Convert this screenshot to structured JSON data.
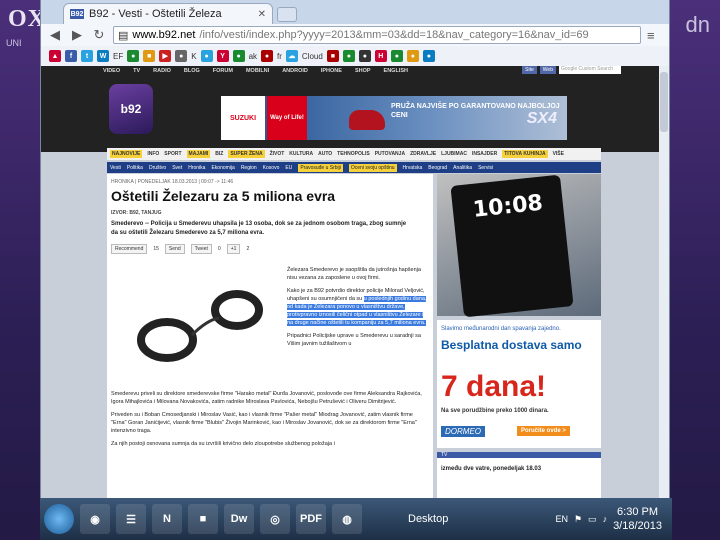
{
  "slide": {
    "title": "OXFORD",
    "subtitle": "UNI",
    "right_text": "dn"
  },
  "browser": {
    "tab_favicon": "B92",
    "tab_title": "B92 - Vesti - Oštetili Železa",
    "url_host": "www.b92.net",
    "url_path": "/info/vesti/index.php?yyyy=2013&mm=03&dd=18&nav_category=16&nav_id=69",
    "bookmarks": [
      "EF",
      "K",
      "ak",
      "fr",
      "Cloud"
    ]
  },
  "site": {
    "nav": [
      "VIDEO",
      "TV",
      "RADIO",
      "BLOG",
      "FORUM",
      "MOBILNI",
      "ANDROID",
      "IPHONE",
      "SHOP",
      "ENGLISH"
    ],
    "search_buttons": [
      "Site",
      "Web"
    ],
    "search_placeholder": "Google Custom Search",
    "logo": "b92",
    "banner_brand": "SUZUKI",
    "banner_slogan": "Way of Life!",
    "banner_text": "PRUŽA NAJVIŠE PO GARANTOVANO NAJBOLJOJ CENI",
    "banner_model": "SX4",
    "categories": [
      "NAJNOVIJE",
      "INFO",
      "SPORT",
      "MAJAMI",
      "BIZ",
      "SUPER ŽENA",
      "ŽIVOT",
      "KULTURA",
      "AUTO",
      "TEHNOPOLIS",
      "PUTOVANJA",
      "ZDRAVLJE",
      "LJUBIMAC",
      "INSAJDER",
      "TITOVA KUHINJA",
      "VIŠE"
    ],
    "subcategories": [
      "Vesti",
      "Politika",
      "Društvo",
      "Svet",
      "Hronika",
      "Ekonomija",
      "Region",
      "Kosovo",
      "EU",
      "Pravosuđe u Srbiji",
      "Oceni svoju opštinu",
      "Hrvatska",
      "Beograd",
      "Analitika",
      "Servisi"
    ]
  },
  "article": {
    "crumbs": "HRONIKA | PONEDELJAK 18.03.2013 | 09:07 -> 11:46",
    "title": "Oštetili Železaru za 5 miliona evra",
    "byline": "IZVOR: B92, TANJUG",
    "lead": "Smederevo -- Policija u Smederevu uhapsila je 13 osoba, dok se za jednom osobom traga, zbog sumnje da su oštetili Železaru Smederevo za 5,7 miliona evra.",
    "social": [
      "Recommend",
      "15",
      "Send",
      "Tweet",
      "0",
      "+1",
      "2"
    ],
    "body_p1": "Železara Smederevo je saopštila da jutrošnja hapšenja nisu vezana za zaposlene u ovoj firmi.",
    "body_p2_start": "Kako je za B92 potvrdio direktor policije Milorad Veljović, uhapšeni su osumnjičeni da su",
    "body_p2_selected": "u poslednjih godinu dana, od kada je Železara ponovo u vlasništvu države, protivpravno iznosili čelični otpad u vlasništvu Železare i na druge načine oštetili tu kompaniju za 5,7 miliona evra.",
    "body_p3": "Pripadnici Policijske uprave u Smederevu u saradnji sa Višim javnim tužilaštvom u",
    "body_p4": "Smederevu priveli su direktore smederevske firme \"Harako metal\" Đurđa Jovanović, poslovođe ove firme Aleksandra Rajkovića, Igora Mihajlovića i Milovana Novakovića, zatim radnike Miroslava Pavlovića, Nebojšu Petrušević i Oliveru Dimitrijević.",
    "body_p5": "Priveden su i Boban Cmosedjanski i Miroslav Vasić, kao i vlasnik firme \"Pašer metal\" Miodrag Jovanović, zatim vlasnik firme \"Erna\" Goran Janićijević, vlasnik firme \"Blubis\" Živojin Marinković, kao i Miroslav Jovanović, dok se za direktorom firme \"Erna\" intenzivno traga.",
    "body_p6": "Za njih postoji osnovana sumnja da su izvršili krivično delo zloupotrebe službenog položaja i"
  },
  "sidebar": {
    "phone_clock": "10:08",
    "promo_line1": "Slavimo međunarodni dan spavanja zajedno.",
    "promo_line2": "Besplatna dostava samo",
    "promo_big": "7 dana!",
    "promo_line3": "Na sve porudžbine preko 1000 dinara.",
    "promo_brand": "DORMEO",
    "promo_button": "Poručite ovde >",
    "tv_label": "TV",
    "tv_text": "između dve vatre, ponedeljak 18.03"
  },
  "taskbar": {
    "apps": [
      "N",
      "Dw",
      "PDF"
    ],
    "desktop_label": "Desktop",
    "time": "6:30 PM",
    "date": "3/18/2013",
    "lang": "EN"
  }
}
